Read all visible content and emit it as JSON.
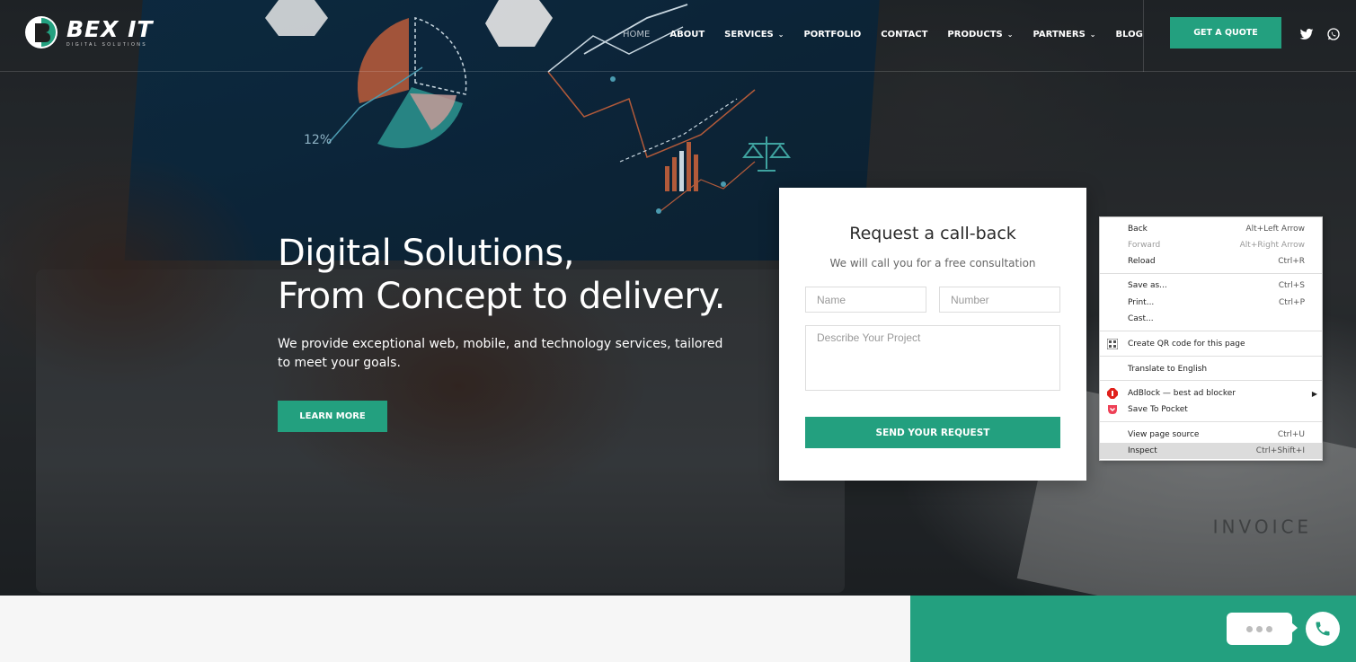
{
  "brand": {
    "name": "BEX IT",
    "tagline": "DIGITAL SOLUTIONS",
    "accent": "#23a07f"
  },
  "nav": {
    "items": [
      {
        "label": "HOME",
        "active": true
      },
      {
        "label": "ABOUT"
      },
      {
        "label": "SERVICES",
        "dropdown": true
      },
      {
        "label": "PORTFOLIO"
      },
      {
        "label": "CONTACT"
      },
      {
        "label": "PRODUCTS",
        "dropdown": true
      },
      {
        "label": "PARTNERS",
        "dropdown": true
      },
      {
        "label": "BLOG"
      }
    ],
    "cta": "GET A QUOTE",
    "social": [
      "twitter-icon",
      "whatsapp-icon"
    ]
  },
  "hero": {
    "title_line1": "Digital Solutions,",
    "title_line2": "From Concept to delivery.",
    "description": "We provide exceptional web, mobile, and technology services, tailored to meet your goals.",
    "button": "LEARN MORE",
    "screen_text": "12%",
    "paper_text": "INVOICE"
  },
  "form": {
    "title": "Request a call-back",
    "subtitle": "We will call you for a free consultation",
    "name_placeholder": "Name",
    "number_placeholder": "Number",
    "project_placeholder": "Describe Your Project",
    "submit": "SEND YOUR REQUEST"
  },
  "context_menu": {
    "items": [
      {
        "label": "Back",
        "shortcut": "Alt+Left Arrow"
      },
      {
        "label": "Forward",
        "shortcut": "Alt+Right Arrow",
        "disabled": true
      },
      {
        "label": "Reload",
        "shortcut": "Ctrl+R"
      },
      {
        "label": "Save as...",
        "shortcut": "Ctrl+S"
      },
      {
        "label": "Print...",
        "shortcut": "Ctrl+P"
      },
      {
        "label": "Cast..."
      },
      {
        "label": "Create QR code for this page",
        "icon": "qr-code-icon"
      },
      {
        "label": "Translate to English"
      },
      {
        "label": "AdBlock — best ad blocker",
        "icon": "adblock-icon",
        "submenu": true
      },
      {
        "label": "Save To Pocket",
        "icon": "pocket-icon"
      },
      {
        "label": "View page source",
        "shortcut": "Ctrl+U"
      },
      {
        "label": "Inspect",
        "shortcut": "Ctrl+Shift+I",
        "highlighted": true
      }
    ]
  },
  "widgets": {
    "chat_icon": "chat-bubble-icon",
    "phone_icon": "phone-icon"
  }
}
